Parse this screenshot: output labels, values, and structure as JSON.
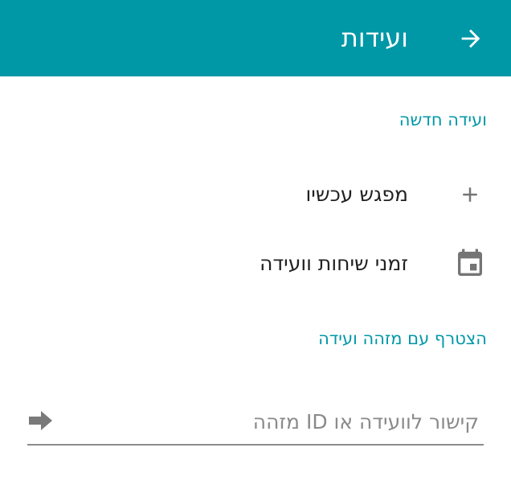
{
  "header": {
    "title": "ועידות",
    "back_icon": "arrow-forward-icon",
    "color": "#0097a7"
  },
  "new_meeting": {
    "section_title": "ועידה חדשה",
    "items": [
      {
        "label": "מפגש עכשיו",
        "icon": "plus-icon"
      },
      {
        "label": "זמני שיחות וועידה",
        "icon": "calendar-icon"
      }
    ]
  },
  "join": {
    "section_title": "הצטרף עם מזהה ועידה",
    "input_placeholder": "קישור לוועידה או ID מזהה",
    "input_value": "",
    "submit_icon": "arrow-right-icon"
  }
}
